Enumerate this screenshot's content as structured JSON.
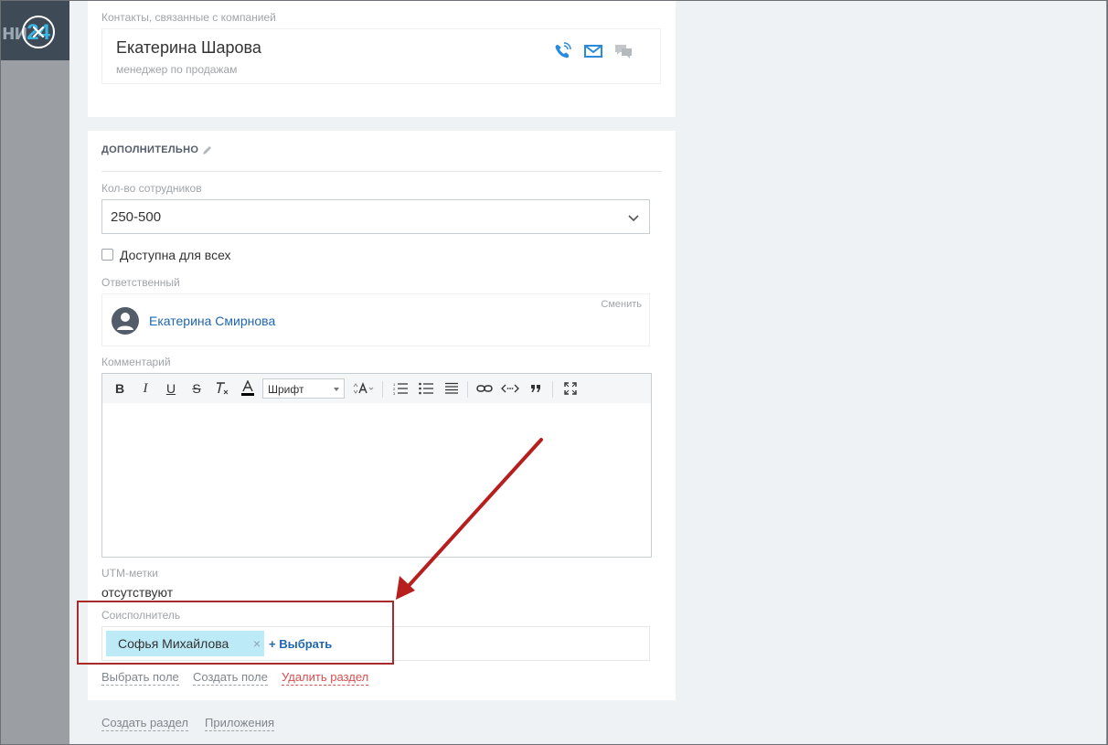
{
  "background_logo_fragment": "ни",
  "background_logo_number": "24",
  "contacts": {
    "header": "Контакты, связанные с компанией",
    "name": "Екатерина Шарова",
    "role": "менеджер по продажам"
  },
  "additional": {
    "title": "ДОПОЛНИТЕЛЬНО",
    "employees_label": "Кол-во сотрудников",
    "employees_value": "250-500",
    "available_label": "Доступна для всех",
    "responsible_label": "Ответственный",
    "responsible_name": "Екатерина Смирнова",
    "change_label": "Сменить",
    "comment_label": "Комментарий",
    "font_select": "Шрифт",
    "utm_label": "UTM-метки",
    "utm_value": "отсутствуют",
    "coexecutor_label": "Соисполнитель",
    "coexecutor_tag": "Софья Михайлова",
    "choose_label": "+ Выбрать"
  },
  "section_links": {
    "select_field": "Выбрать поле",
    "create_field": "Создать поле",
    "delete_section": "Удалить раздел"
  },
  "footer_links": {
    "create_section": "Создать раздел",
    "applications": "Приложения"
  },
  "toolbar_glyphs": {
    "bold": "B",
    "italic": "I",
    "underline": "U",
    "strike": "S"
  },
  "colors": {
    "accent_link": "#2067b0",
    "tag_bg": "#bdeaf7",
    "highlight": "#a92a2a",
    "danger": "#d84e4e"
  }
}
